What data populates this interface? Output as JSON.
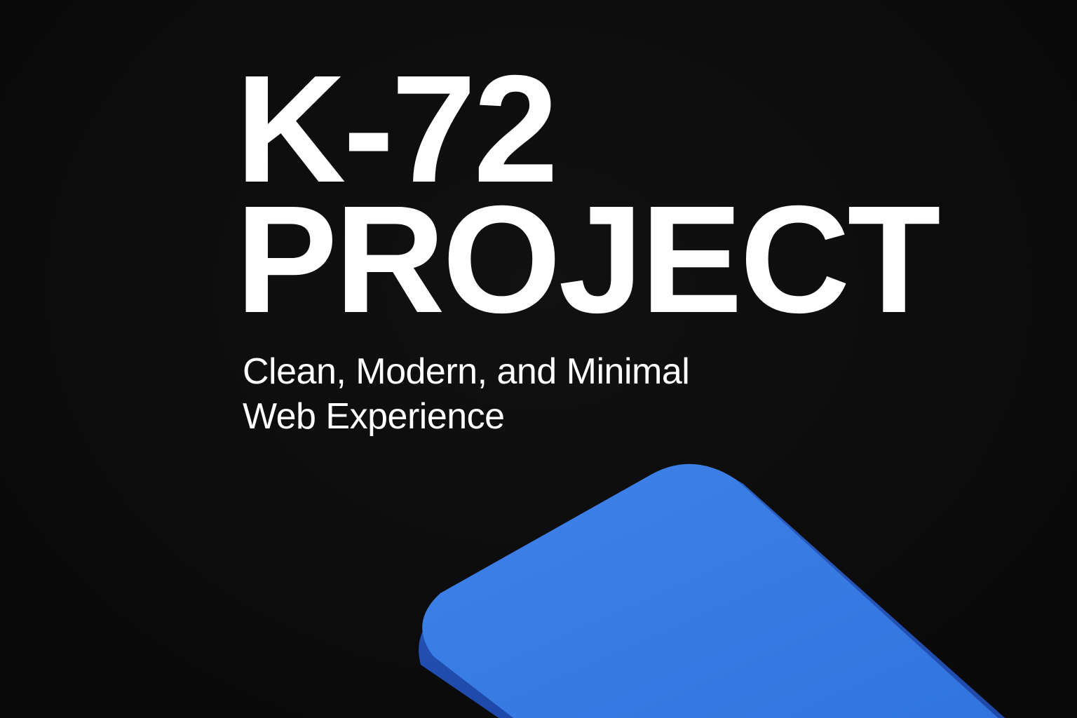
{
  "hero": {
    "title_line_1": "K-72",
    "title_line_2": "PROJECT",
    "subtitle_line_1": "Clean, Modern, and Minimal",
    "subtitle_line_2": "Web Experience"
  },
  "colors": {
    "background": "#0c0c0c",
    "text": "#ffffff",
    "accent": "#3a7be0"
  }
}
